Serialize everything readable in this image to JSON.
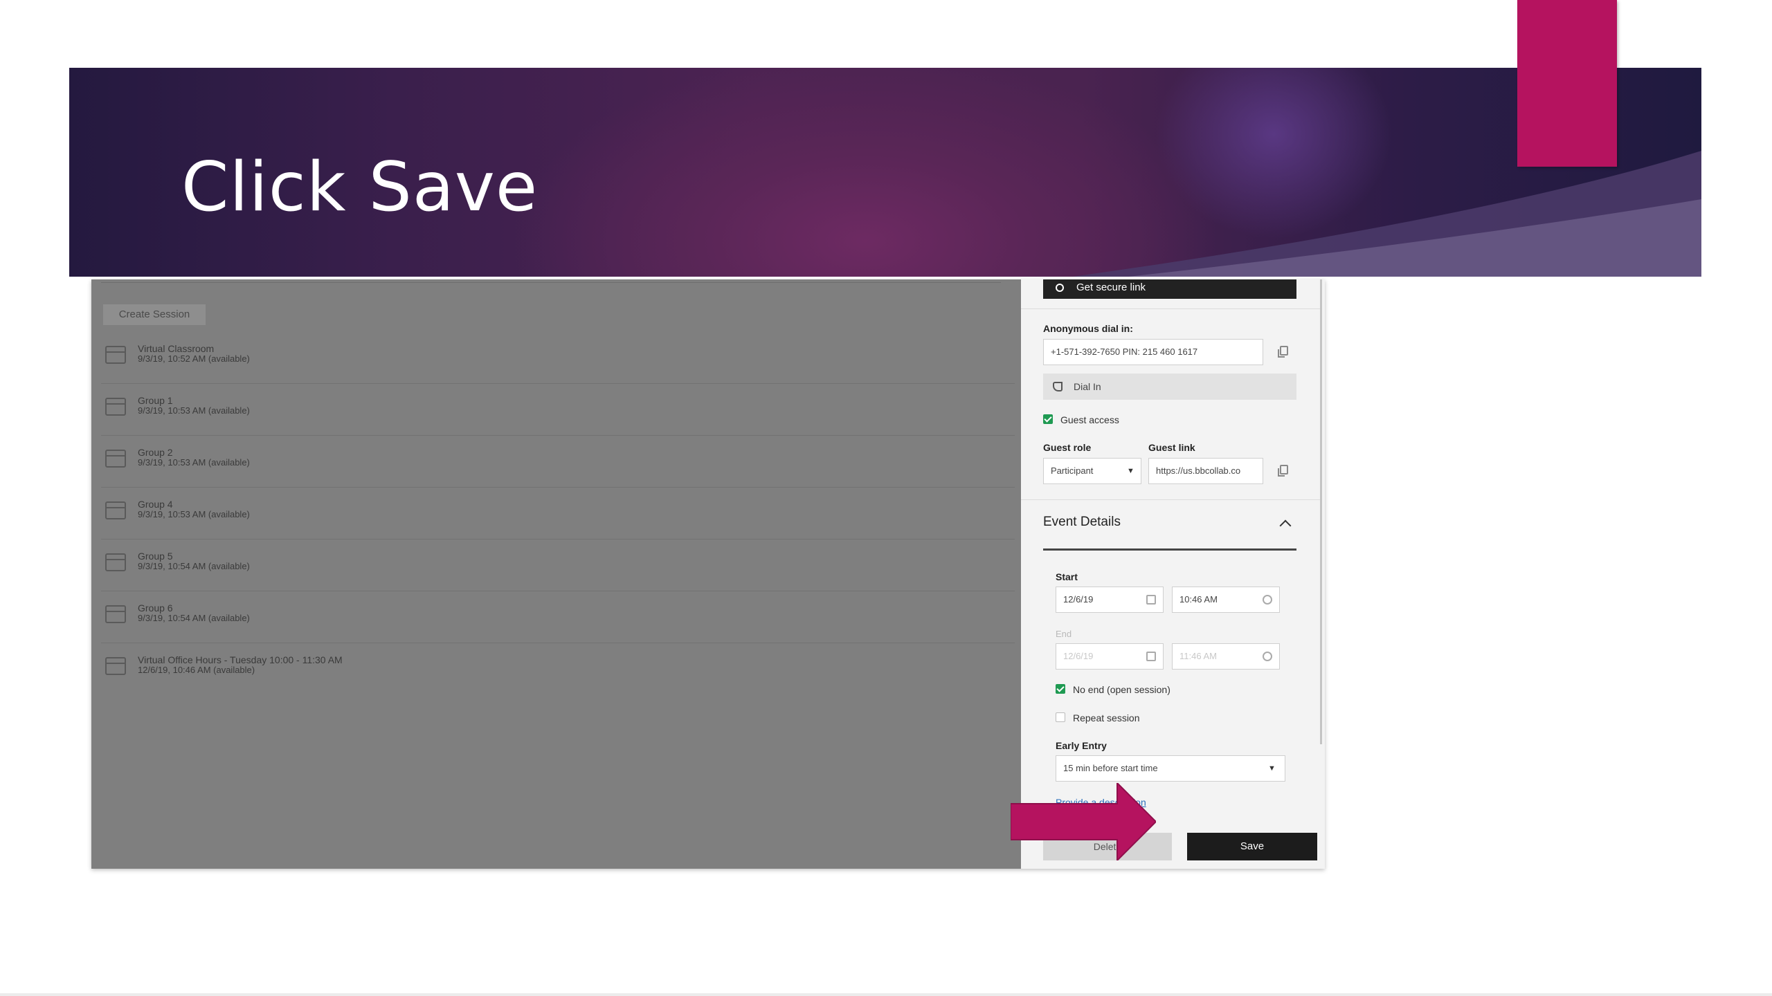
{
  "slide": {
    "title": "Click Save",
    "colors": {
      "banner_dark": "#24193f",
      "banner_mid": "#6d2a62",
      "accent": "#b5135f",
      "pointer": "#b5135f"
    }
  },
  "sessions_panel": {
    "create_label": "Create Session",
    "sessions": [
      {
        "name": "Virtual Classroom",
        "meta": "9/3/19, 10:52 AM (available)"
      },
      {
        "name": "Group 1",
        "meta": "9/3/19, 10:53 AM (available)"
      },
      {
        "name": "Group 2",
        "meta": "9/3/19, 10:53 AM (available)"
      },
      {
        "name": "Group 4",
        "meta": "9/3/19, 10:53 AM (available)"
      },
      {
        "name": "Group 5",
        "meta": "9/3/19, 10:54 AM (available)"
      },
      {
        "name": "Group 6",
        "meta": "9/3/19, 10:54 AM (available)"
      },
      {
        "name": "Virtual Office Hours - Tuesday 10:00 - 11:30 AM",
        "meta": "12/6/19, 10:46 AM (available)"
      }
    ]
  },
  "settings_panel": {
    "secure_link_label": "Get secure link",
    "anon_dial_label": "Anonymous dial in:",
    "anon_dial_value": "+1-571-392-7650 PIN: 215 460 1617",
    "dial_in_label": "Dial In",
    "guest_access_label": "Guest access",
    "guest_role_label": "Guest role",
    "guest_role_value": "Participant",
    "guest_link_label": "Guest link",
    "guest_link_value": "https://us.bbcollab.co",
    "event_details_title": "Event Details",
    "start_label": "Start",
    "start_date": "12/6/19",
    "start_time": "10:46 AM",
    "end_label": "End",
    "end_date": "12/6/19",
    "end_time": "11:46 AM",
    "no_end_label": "No end (open session)",
    "repeat_label": "Repeat session",
    "early_entry_label": "Early Entry",
    "early_entry_value": "15 min before start time",
    "description_link": "Provide a description",
    "delete_label": "Delete",
    "save_label": "Save"
  }
}
